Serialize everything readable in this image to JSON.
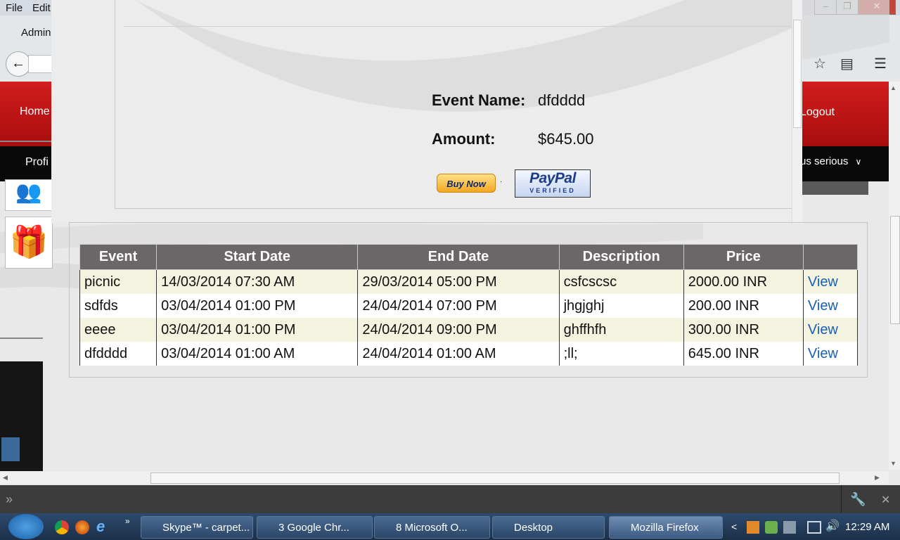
{
  "browser": {
    "menu": [
      "File",
      "Edit"
    ],
    "tab_label": "Admin",
    "window_buttons": [
      "–",
      "❐",
      "✕"
    ]
  },
  "site": {
    "nav_home": "Home",
    "nav_logout": "Logout",
    "nav_profile": "Profi",
    "nav_user": "us serious"
  },
  "popup": {
    "event_name_label": "Event Name:",
    "event_name_value": "dfdddd",
    "amount_label": "Amount:",
    "amount_value": "$645.00",
    "buy_now": "Buy Now",
    "paypal": "PayPal",
    "verified": "VERIFIED"
  },
  "table": {
    "headers": [
      "Event",
      "Start Date",
      "End Date",
      "Description",
      "Price",
      ""
    ],
    "rows": [
      [
        "picnic",
        "14/03/2014 07:30 AM",
        "29/03/2014 05:00 PM",
        "csfcscsc",
        "2000.00 INR",
        "View"
      ],
      [
        "sdfds",
        "03/04/2014 01:00 PM",
        "24/04/2014 07:00 PM",
        "jhgjghj",
        "200.00 INR",
        "View"
      ],
      [
        "eeee",
        "03/04/2014 01:00 PM",
        "24/04/2014 09:00 PM",
        "ghffhfh",
        "300.00 INR",
        "View"
      ],
      [
        "dfdddd",
        "03/04/2014 01:00 AM",
        "24/04/2014 01:00 AM",
        ";ll;",
        "645.00 INR",
        "View"
      ]
    ]
  },
  "taskbar": {
    "items": [
      {
        "label": "Skype™ - carpet..."
      },
      {
        "label": "3 Google Chr..."
      },
      {
        "label": "8 Microsoft O..."
      },
      {
        "label": "Desktop"
      },
      {
        "label": "Mozilla Firefox"
      }
    ],
    "clock": "12:29 AM"
  },
  "icons": [
    "back-icon",
    "star-icon",
    "reading-list-icon",
    "menu-icon",
    "gift-icon",
    "wrench-icon",
    "close-icon"
  ]
}
